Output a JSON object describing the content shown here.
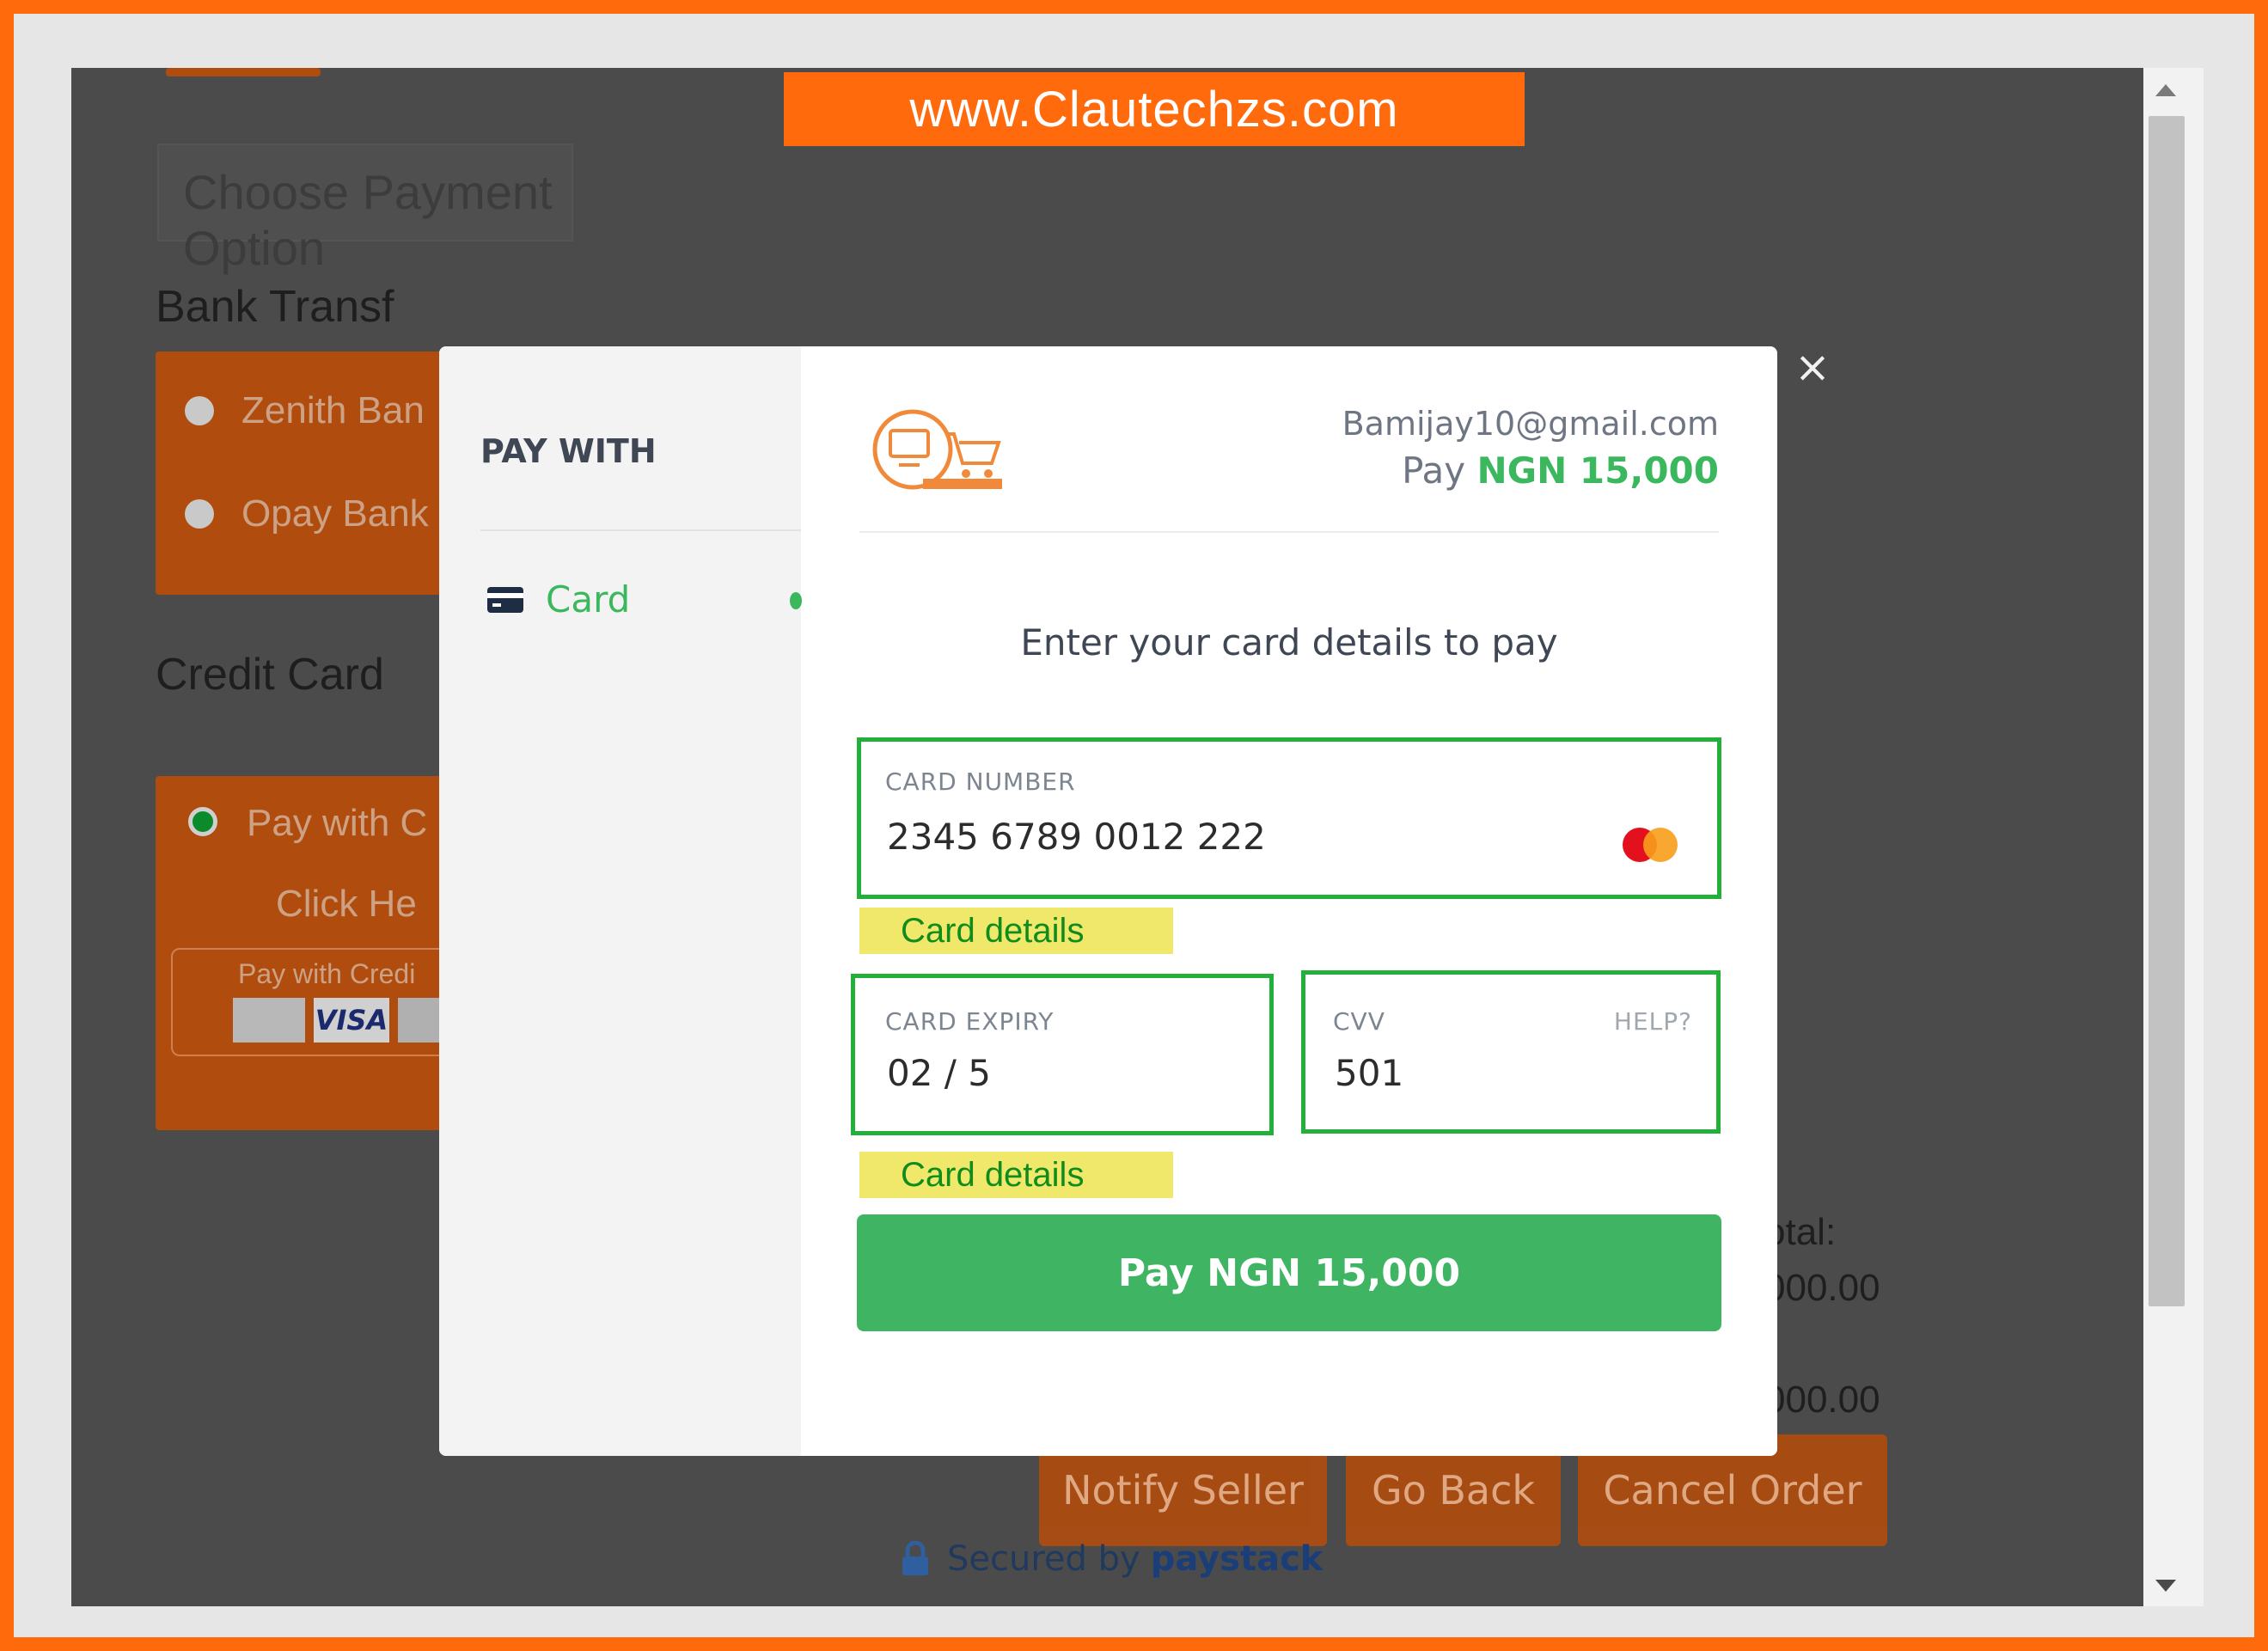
{
  "banner": {
    "text": "www.Clautechzs.com"
  },
  "background_page": {
    "section_title": "Choose Payment Option",
    "bank_transfer_heading": "Bank Transf",
    "bank_options": [
      "Zenith Ban",
      "Opay Bank"
    ],
    "credit_card_heading": "Credit Card",
    "credit_option": "Pay with C",
    "click_here": "Click He",
    "card_strip_label": "Pay with Credi",
    "card_brands": [
      "VISA"
    ],
    "totals": [
      "otal:",
      "000.00",
      ":",
      "000.00"
    ],
    "buttons": {
      "notify_seller": "Notify Seller",
      "go_back": "Go Back",
      "cancel_order": "Cancel Order"
    },
    "secured_by": "Secured by",
    "paystack": "paystack"
  },
  "modal": {
    "sidebar": {
      "title": "PAY WITH",
      "items": [
        {
          "label": "Card",
          "icon": "credit-card-icon"
        }
      ]
    },
    "header": {
      "email": "Bamijay10@gmail.com",
      "pay_prefix": "Pay",
      "amount": "NGN 15,000"
    },
    "instruction": "Enter your card details to pay",
    "fields": {
      "card_number": {
        "label": "CARD NUMBER",
        "value": "2345 6789 0012 222"
      },
      "card_expiry": {
        "label": "CARD EXPIRY",
        "value": "02 / 5"
      },
      "cvv": {
        "label": "CVV",
        "help": "HELP?",
        "value": "501"
      }
    },
    "annotations": [
      "Card details",
      "Card details"
    ],
    "pay_button": "Pay NGN 15,000",
    "close": "×"
  },
  "colors": {
    "accent_green": "#3bb75e",
    "highlight_green": "#22b03a",
    "brand_orange": "#ff6a0d"
  }
}
